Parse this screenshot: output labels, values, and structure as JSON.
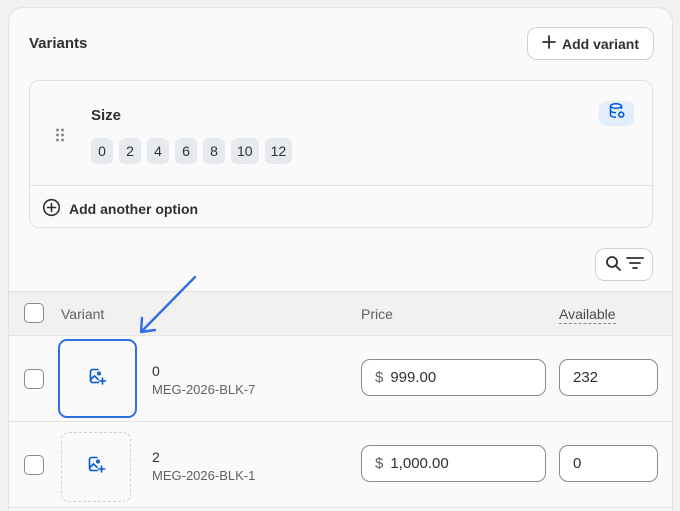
{
  "variants_card": {
    "title": "Variants",
    "add_variant_label": "Add variant"
  },
  "option": {
    "name": "Size",
    "values": [
      "0",
      "2",
      "4",
      "6",
      "8",
      "10",
      "12"
    ],
    "add_another_label": "Add another option"
  },
  "table": {
    "headers": {
      "variant": "Variant",
      "price": "Price",
      "available": "Available"
    },
    "rows": [
      {
        "name": "0",
        "sku": "MEG-2026-BLK-7",
        "currency": "$",
        "price": "999.00",
        "available": "232"
      },
      {
        "name": "2",
        "sku": "MEG-2026-BLK-1",
        "currency": "$",
        "price": "1,000.00",
        "available": "0"
      }
    ]
  },
  "icons": {
    "add": "plus-icon",
    "drag": "drag-handle-icon",
    "database": "database-icon",
    "add_option": "circle-plus-icon",
    "search": "search-icon",
    "filter": "filter-icon",
    "image_add": "image-add-icon",
    "annotation": "arrow-annotation"
  },
  "colors": {
    "accent_blue": "#2f6fe0",
    "icon_blue": "#005bd3",
    "text": "#303030",
    "muted": "#616161"
  }
}
